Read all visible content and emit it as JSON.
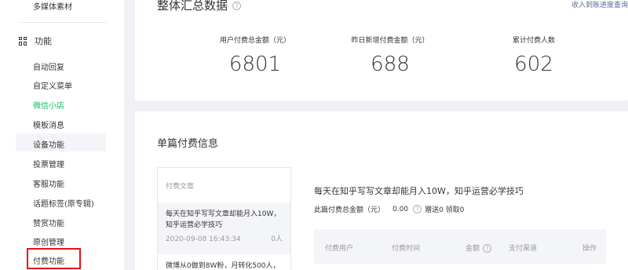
{
  "sidebar": {
    "top_item": "多媒体素材",
    "section_label": "功能",
    "items": [
      "自动回复",
      "自定义菜单",
      "微信小店",
      "模板消息",
      "设备功能",
      "投票管理",
      "客服功能",
      "话题标签(原专辑)",
      "赞赏功能",
      "原创管理",
      "付费功能"
    ],
    "active_item": "微信小店",
    "hover_item": "设备功能",
    "boxed_item": "付费功能"
  },
  "summary": {
    "title": "整体汇总数据",
    "help_icon": "?",
    "link": "收入到账进度查询",
    "stats": [
      {
        "label": "用户付费总金额（元）",
        "value": "6801"
      },
      {
        "label": "昨日新增付费金额（元）",
        "value": "688"
      },
      {
        "label": "累计付费人数",
        "value": "602"
      }
    ]
  },
  "single": {
    "title": "单篇付费信息",
    "list_header": "付费文章",
    "articles": [
      {
        "title": "每天在知乎写写文章却能月入10W，知乎运营必学技巧",
        "date": "2020-09-08 16:43:34",
        "count": "0人"
      },
      {
        "title": "微博从0做到8W粉，月转化500人，"
      }
    ],
    "detail": {
      "title": "每天在知乎写写文章却能月入10W，知乎运营必学技巧",
      "total_label": "此篇付费总金额（元）",
      "total_value": "0.00",
      "gift_text": "赠送0 领取0"
    },
    "table_headers": [
      "付费用户",
      "付费时间",
      "金额",
      "支付渠道",
      "操作"
    ]
  },
  "colors": {
    "accent": "#07c160",
    "link": "#576b95",
    "highlight_box": "#e8101b"
  }
}
